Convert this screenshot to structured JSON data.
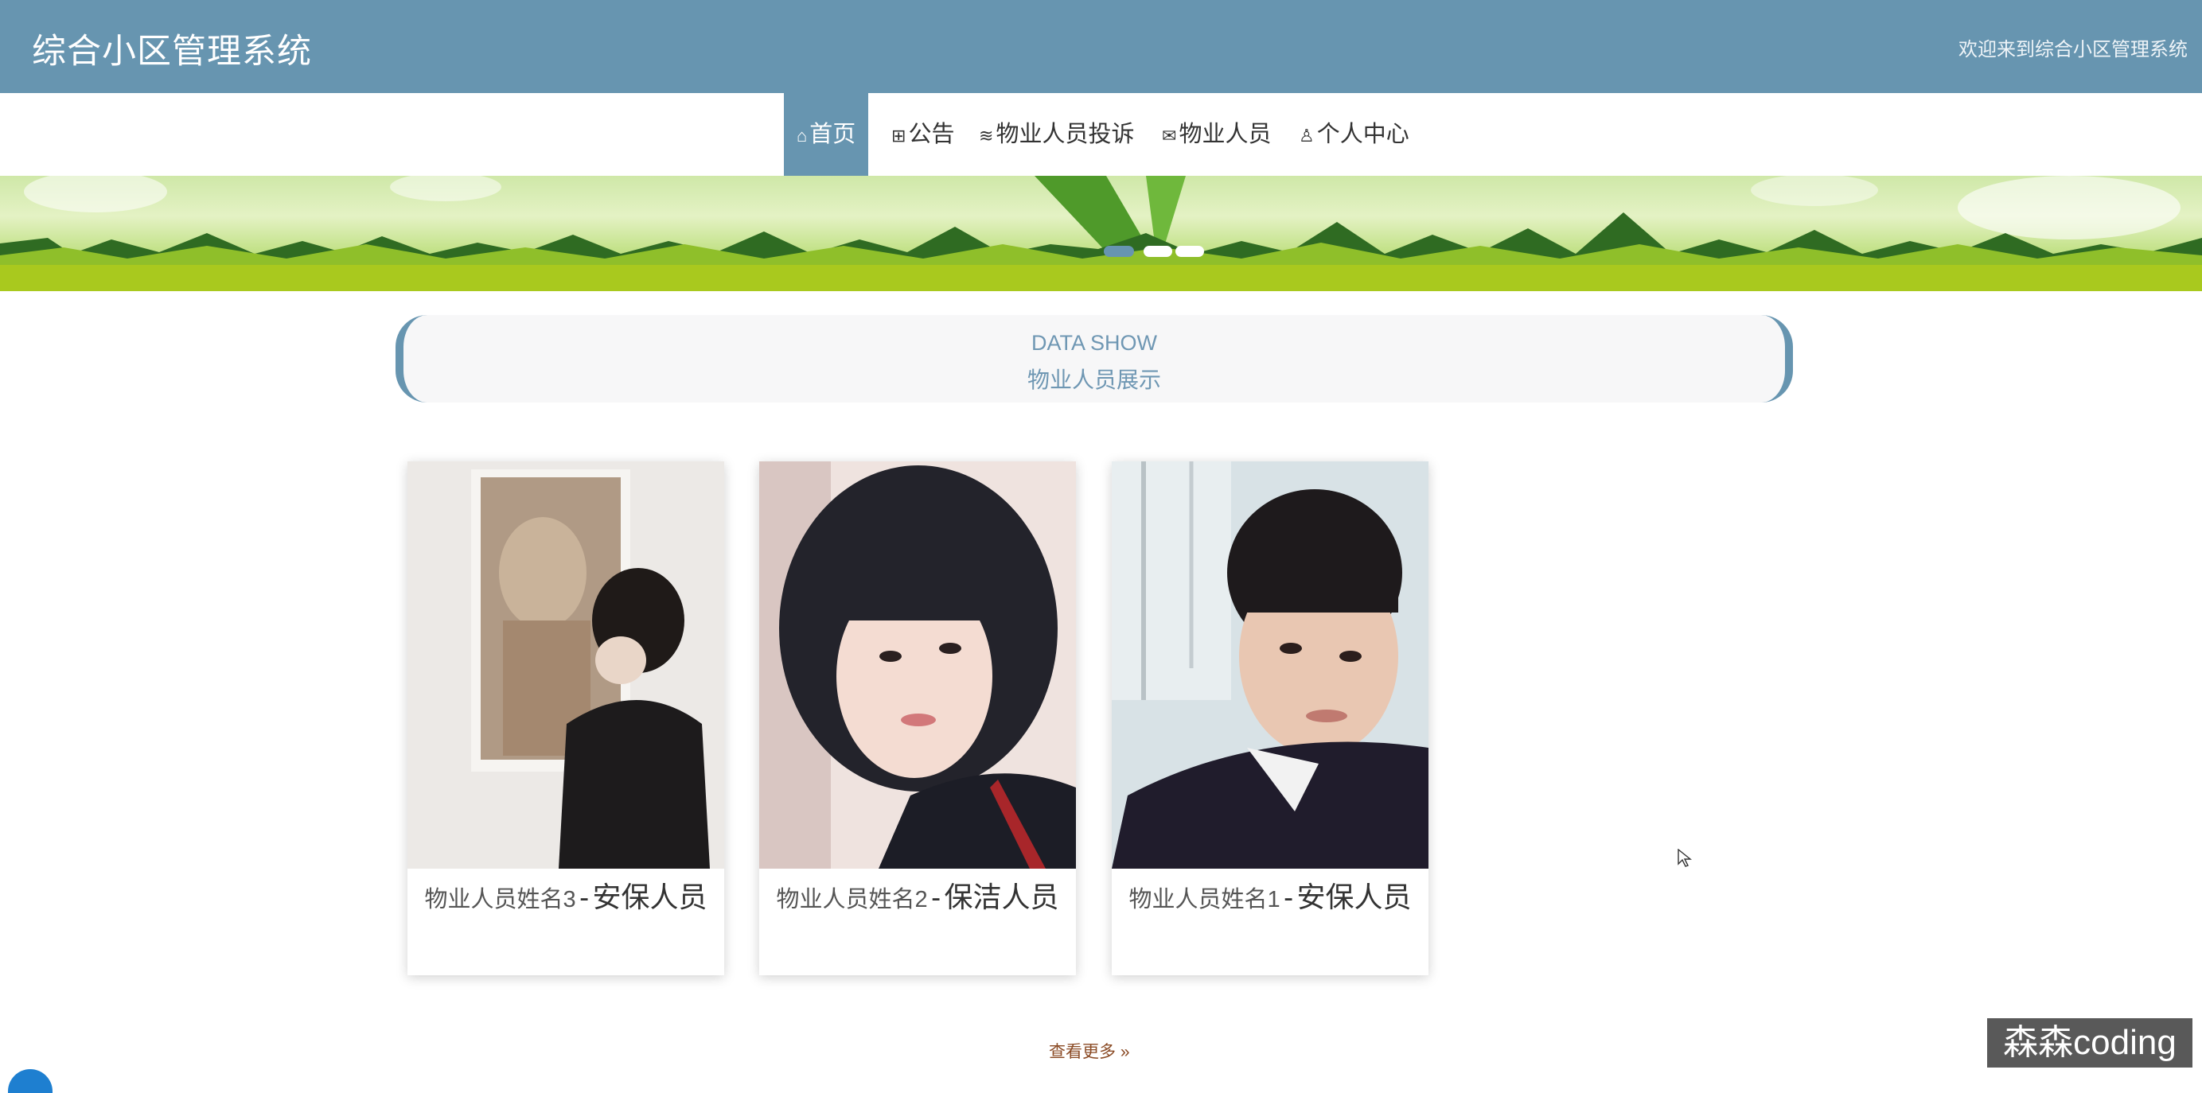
{
  "header": {
    "title": "综合小区管理系统",
    "welcome": "欢迎来到综合小区管理系统"
  },
  "nav": {
    "items": [
      {
        "label": "首页",
        "icon": "home-icon",
        "active": true
      },
      {
        "label": "公告",
        "icon": "gift-icon",
        "active": false
      },
      {
        "label": "物业人员投诉",
        "icon": "book-icon",
        "active": false
      },
      {
        "label": "物业人员",
        "icon": "mail-icon",
        "active": false
      },
      {
        "label": "个人中心",
        "icon": "user-icon",
        "active": false
      }
    ]
  },
  "carousel": {
    "slide_count": 3,
    "active_index": 0
  },
  "section": {
    "title_en": "DATA SHOW",
    "title_cn": "物业人员展示"
  },
  "cards": [
    {
      "name": "物业人员姓名3",
      "separator": "-",
      "role": "安保人员"
    },
    {
      "name": "物业人员姓名2",
      "separator": "-",
      "role": "保洁人员"
    },
    {
      "name": "物业人员姓名1",
      "separator": "-",
      "role": "安保人员"
    }
  ],
  "more": {
    "label": "查看更多",
    "icon": "double-chevron-right-icon"
  },
  "watermark": {
    "text": "森森coding"
  },
  "colors": {
    "primary": "#6795b0",
    "banner_green": "#9cc528",
    "more_link": "#8a4a24"
  }
}
